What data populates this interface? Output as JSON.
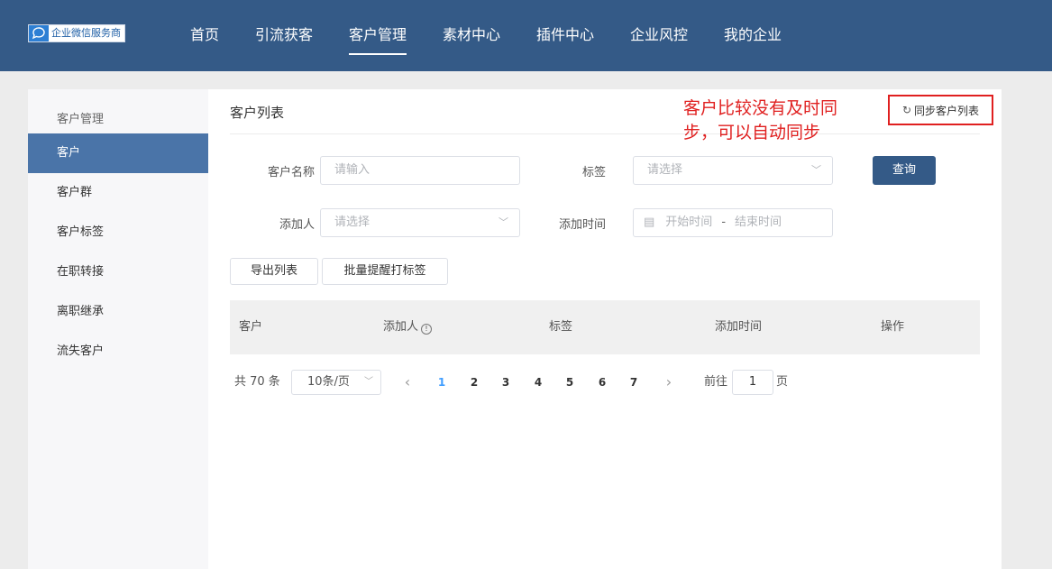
{
  "header": {
    "logo_text": "企业微信服务商",
    "nav": [
      "首页",
      "引流获客",
      "客户管理",
      "素材中心",
      "插件中心",
      "企业风控",
      "我的企业"
    ],
    "active_nav": "客户管理"
  },
  "sidebar": {
    "title": "客户管理",
    "items": [
      {
        "label": "客户",
        "active": true
      },
      {
        "label": "客户群"
      },
      {
        "label": "客户标签"
      },
      {
        "label": "在职转接"
      },
      {
        "label": "离职继承"
      },
      {
        "label": "流失客户"
      }
    ]
  },
  "main": {
    "title": "客户列表",
    "sync_label": "同步客户列表",
    "note": "客户比较没有及时同步，可以自动同步",
    "filters": {
      "customer_name_label": "客户名称",
      "customer_name_placeholder": "请输入",
      "tag_label": "标签",
      "tag_placeholder": "请选择",
      "adder_label": "添加人",
      "adder_placeholder": "请选择",
      "time_label": "添加时间",
      "start_placeholder": "开始时间",
      "range_sep": "-",
      "end_placeholder": "结束时间",
      "search_label": "查询"
    },
    "actions": {
      "export_label": "导出列表",
      "batch_tag_label": "批量提醒打标签"
    },
    "table": {
      "columns": [
        "客户",
        "添加人",
        "标签",
        "添加时间",
        "操作"
      ]
    },
    "pagination": {
      "total_text": "共 70 条",
      "page_size": "10条/页",
      "pages": [
        "1",
        "2",
        "3",
        "4",
        "5",
        "6",
        "7"
      ],
      "current": "1",
      "goto_prefix": "前往",
      "goto_value": "1",
      "goto_suffix": "页"
    }
  },
  "colors": {
    "header_bg": "#345a87",
    "sidebar_active": "#4a74a8",
    "primary": "#345a87",
    "annotation": "#e02020",
    "page_active": "#409eff"
  }
}
